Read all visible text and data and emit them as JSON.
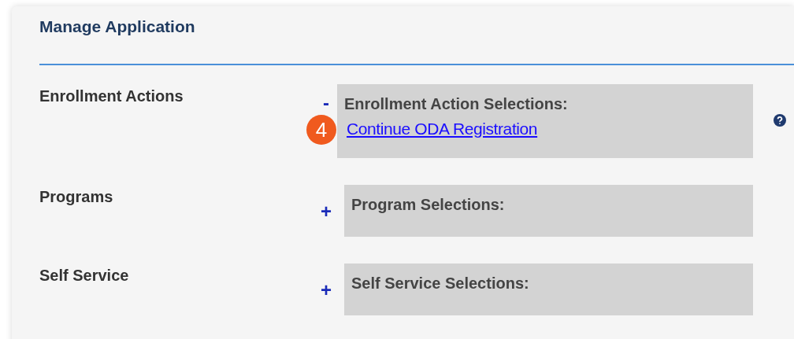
{
  "title": "Manage Application",
  "sections": [
    {
      "label": "Enrollment Actions",
      "toggle": "-",
      "expanded": true,
      "heading": "Enrollment Action Selections:",
      "help": true,
      "links": [
        {
          "text": "Continue ODA Registration",
          "badge": "4"
        }
      ]
    },
    {
      "label": "Programs",
      "toggle": "+",
      "expanded": false,
      "heading": "Program Selections:",
      "help": false
    },
    {
      "label": "Self Service",
      "toggle": "+",
      "expanded": false,
      "heading": "Self Service Selections:",
      "help": false
    }
  ]
}
